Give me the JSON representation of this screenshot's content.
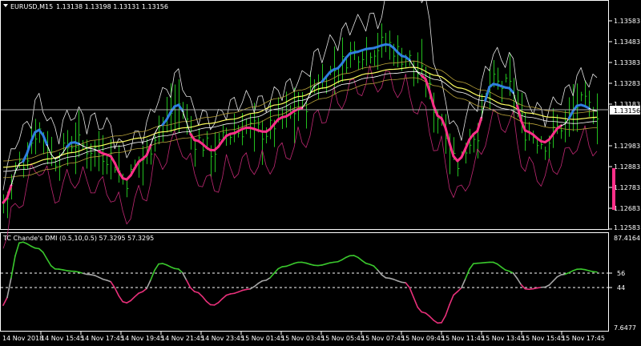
{
  "header": {
    "symbol_label": "EURUSD,M15",
    "ohlc_text": "1.13138 1.13198 1.13131 1.13156",
    "indicator_title": "TC Chande's DMI (0.5,10,0.5) 57.3295 57.3295"
  },
  "price_axis": {
    "ticks": [
      "1.13583",
      "1.13483",
      "1.13383",
      "1.13283",
      "1.13183",
      "1.12983",
      "1.12883",
      "1.12783",
      "1.12683",
      "1.12583"
    ],
    "current_price": "1.13156"
  },
  "indicator_axis": {
    "ticks": [
      "87.4164",
      "56",
      "44",
      "7.6477"
    ]
  },
  "time_axis": {
    "ticks": [
      "14 Nov 2018",
      "14 Nov 15:45",
      "14 Nov 17:45",
      "14 Nov 19:45",
      "14 Nov 21:45",
      "14 Nov 23:45",
      "15 Nov 01:45",
      "15 Nov 03:45",
      "15 Nov 05:45",
      "15 Nov 07:45",
      "15 Nov 09:45",
      "15 Nov 11:45",
      "15 Nov 13:45",
      "15 Nov 15:45",
      "15 Nov 17:45"
    ]
  },
  "colors": {
    "background": "#000000",
    "axis": "#ffffff",
    "bars": "#22c01f",
    "trend_up": "#2f7fe0",
    "trend_down": "#ff2f88",
    "ma_white": "#ffffff",
    "ma_yellow": "#ffff60",
    "ma_olive": "#b8a23a",
    "band_white": "#e6e6e6",
    "band_pink": "#c02873",
    "dmi_green": "#3ac82d",
    "dmi_gray": "#a6a6a6",
    "dmi_magenta": "#e8307a"
  },
  "chart_data": {
    "type": "line",
    "title": "EURUSD,M15",
    "x": [
      "14 Nov 2018",
      "14 Nov 15:45",
      "14 Nov 17:45",
      "14 Nov 19:45",
      "14 Nov 21:45",
      "14 Nov 23:45",
      "15 Nov 01:45",
      "15 Nov 03:45",
      "15 Nov 05:45",
      "15 Nov 07:45",
      "15 Nov 09:45",
      "15 Nov 11:45",
      "15 Nov 13:45",
      "15 Nov 15:45",
      "15 Nov 17:45"
    ],
    "ylim": [
      1.12583,
      1.13683
    ],
    "series": [
      {
        "values": [
          1.1281,
          1.1302,
          1.1295,
          1.1284,
          1.1321,
          1.1309,
          1.131,
          1.1334,
          1.1346,
          1.1342,
          1.133,
          1.1292,
          1.1306,
          1.1303,
          1.1313
        ]
      },
      {
        "values": [
          1.1285,
          1.1294,
          1.1298,
          1.1298,
          1.1303,
          1.1306,
          1.1313,
          1.1319,
          1.1325,
          1.133,
          1.1334,
          1.1322,
          1.1317,
          1.131,
          1.1313
        ]
      }
    ],
    "indicator": {
      "title": "TC Chande's DMI (0.5,10,0.5) 57.3295 57.3295",
      "ylim": [
        7.6477,
        87.4164
      ],
      "levels": [
        56,
        44
      ],
      "values": [
        28,
        84,
        58,
        55,
        40,
        60,
        42,
        45,
        65,
        70,
        48,
        12,
        63,
        44,
        57.3295
      ]
    }
  }
}
